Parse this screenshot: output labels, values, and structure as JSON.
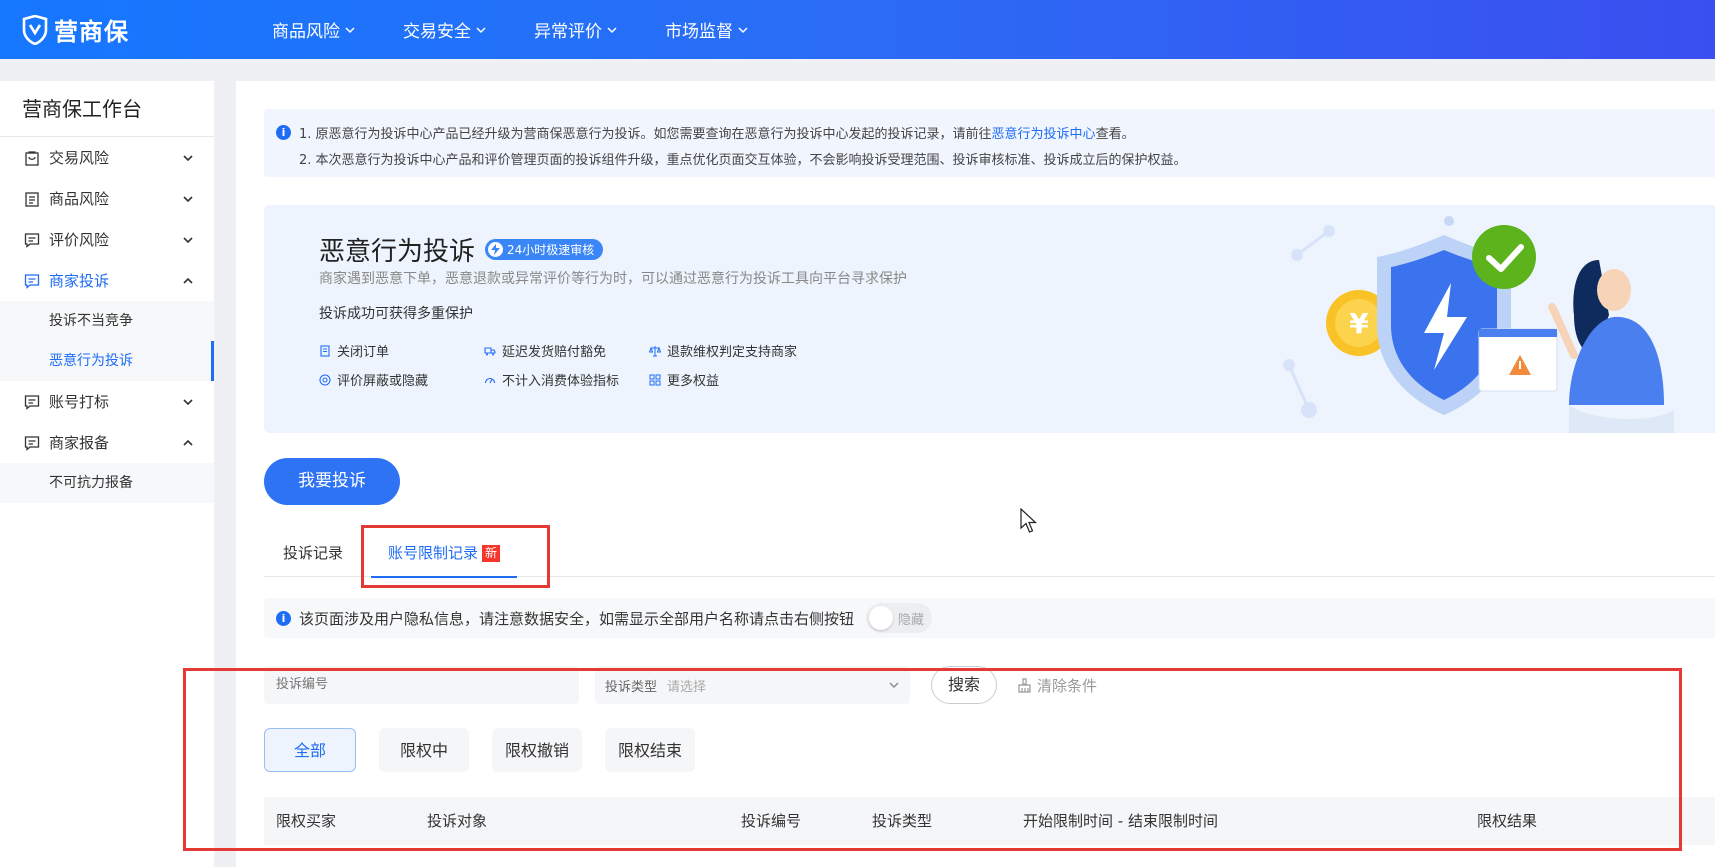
{
  "brand": {
    "name": "营商保",
    "color": "#1f6cf5"
  },
  "topnav": [
    {
      "label": "商品风险"
    },
    {
      "label": "交易安全"
    },
    {
      "label": "异常评价"
    },
    {
      "label": "市场监督"
    }
  ],
  "sidebar": {
    "title": "营商保工作台",
    "groups": [
      {
        "label": "交易风险",
        "icon": "bag-icon"
      },
      {
        "label": "商品风险",
        "icon": "clipboard-icon"
      },
      {
        "label": "评价风险",
        "icon": "comment-icon"
      },
      {
        "label": "商家投诉",
        "icon": "comment-icon",
        "expanded": true,
        "children": [
          "投诉不当竞争",
          "恶意行为投诉"
        ]
      },
      {
        "label": "账号打标",
        "icon": "comment-icon"
      },
      {
        "label": "商家报备",
        "icon": "comment-icon",
        "expanded": true,
        "children": [
          "不可抗力报备"
        ]
      }
    ]
  },
  "notice": {
    "line1_prefix": "1. 原恶意行为投诉中心产品已经升级为营商保恶意行为投诉。如您需要查询在恶意行为投诉中心发起的投诉记录，请前往",
    "line1_link": "恶意行为投诉中心",
    "line1_suffix": "查看。",
    "line2": "2. 本次恶意行为投诉中心产品和评价管理页面的投诉组件升级，重点优化页面交互体验，不会影响投诉受理范围、投诉审核标准、投诉成立后的保护权益。"
  },
  "banner": {
    "title": "恶意行为投诉",
    "badge": "24小时极速审核",
    "desc": "商家遇到恶意下单，恶意退款或异常评价等行为时，可以通过恶意行为投诉工具向平台寻求保护",
    "subtitle": "投诉成功可获得多重保护",
    "benefits": [
      "关闭订单",
      "延迟发货赔付豁免",
      "退款维权判定支持商家",
      "评价屏蔽或隐藏",
      "不计入消费体验指标",
      "更多权益"
    ]
  },
  "actions": {
    "complain": "我要投诉"
  },
  "tabs": {
    "records": "投诉记录",
    "restrictions": "账号限制记录",
    "new_badge": "新"
  },
  "privacy": {
    "text": "该页面涉及用户隐私信息，请注意数据安全，如需显示全部用户名称请点击右侧按钮",
    "toggle_label": "隐藏"
  },
  "filters": {
    "complaint_no_placeholder": "投诉编号",
    "type_label": "投诉类型",
    "type_placeholder": "请选择",
    "search": "搜索",
    "clear": "清除条件"
  },
  "status_tabs": [
    "全部",
    "限权中",
    "限权撤销",
    "限权结束"
  ],
  "table": {
    "headers": [
      "限权买家",
      "投诉对象",
      "投诉编号",
      "投诉类型",
      "开始限制时间 - 结束限制时间",
      "限权结果"
    ]
  }
}
